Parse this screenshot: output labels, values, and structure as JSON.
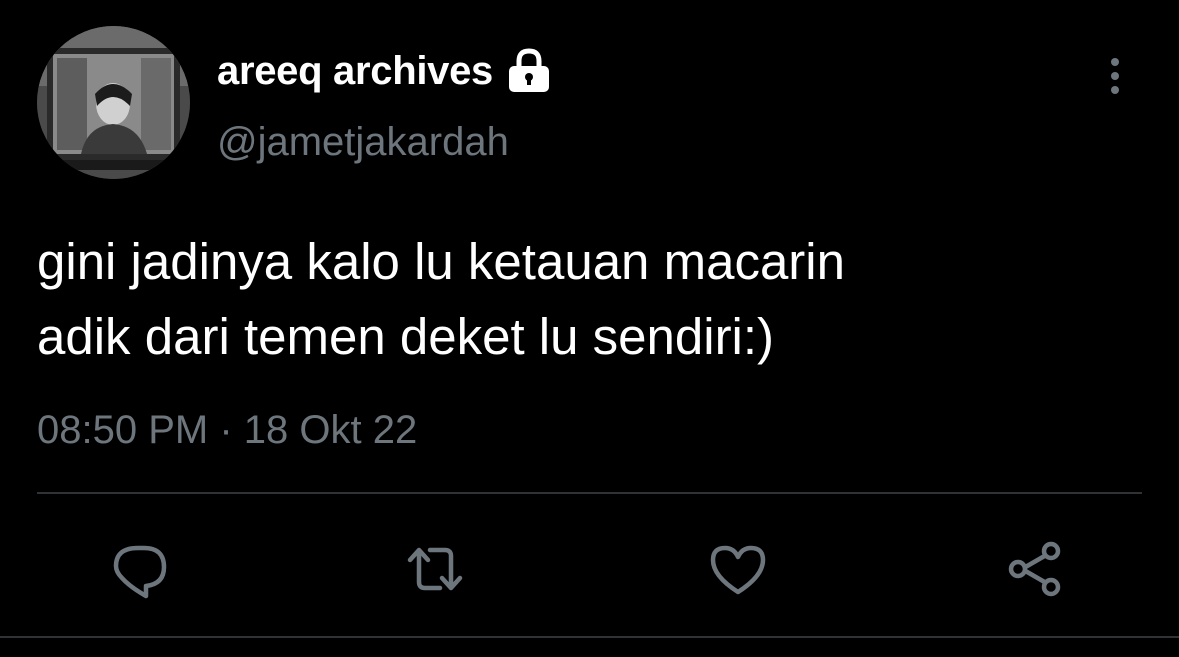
{
  "tweet": {
    "author": {
      "display_name": "areeq archives",
      "handle": "@jametjakardah",
      "protected_icon": "lock-icon"
    },
    "text_lines": [
      "gini jadinya kalo lu ketauan macarin",
      "adik dari temen deket lu sendiri:)"
    ],
    "timestamp": "08:50 PM · 18 Okt 22"
  },
  "actions": {
    "reply_icon": "reply-icon",
    "retweet_icon": "retweet-icon",
    "like_icon": "heart-icon",
    "share_icon": "share-icon"
  },
  "menu": {
    "more_icon": "more-vertical-icon"
  },
  "colors": {
    "background": "#000000",
    "text_primary": "#ffffff",
    "text_secondary": "#6e767d",
    "divider": "#2f3336"
  }
}
